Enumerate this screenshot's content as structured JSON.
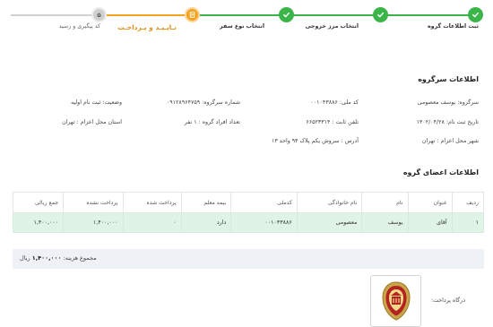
{
  "stepper": {
    "steps": [
      {
        "label": "ثبت اطلاعات گروه",
        "state": "done"
      },
      {
        "label": "انتخاب مرز خروجی",
        "state": "done"
      },
      {
        "label": "انتخاب نوع سفر",
        "state": "done"
      },
      {
        "label": "تـایـیـد و پـرداخـت",
        "state": "current"
      },
      {
        "label": "کد پیگیری و رسید",
        "state": "todo",
        "number": "۵"
      }
    ],
    "colors": {
      "done": "#3bb54a",
      "current": "#f4a21f",
      "todo": "#cfcfcf"
    }
  },
  "leader": {
    "title": "اطلاعات سرگروه",
    "name": "سرگروه: یوسف معصومی",
    "national_code": "کد ملی: ۰۰۱۰۴۳۸۸۶",
    "leader_number": "شماره سرگروه: ۰۹۱۲۸۹۶۴۷۵۹",
    "status": "وضعیت: ثبت نام اولیه",
    "register_date": "تاریخ ثبت نام: ۱۴۰۲/۰۴/۲۸",
    "landline": "تلفن ثابت : ۶۶۵۲۳۳۱۴",
    "group_count": "تعداد افراد گروه : ۱ نفر",
    "province": "استان محل اعزام : تهران",
    "city": "شهر محل اعزام : تهران",
    "address": "آدرس : سروش یکم پلاک ۹۴ واحد ۱۳"
  },
  "members": {
    "title": "اطلاعات اعضای گروه",
    "columns": [
      "ردیف",
      "عنوان",
      "نام",
      "نام خانوادگی",
      "کدملی",
      "بیمه معلم",
      "پرداخت شده",
      "پرداخت نشده",
      "جمع ریالی"
    ],
    "rows": [
      [
        "۱",
        "آقای",
        "یوسف",
        "معصومی",
        "۰۰۱۰۴۳۸۸۶",
        "دارد",
        "۰",
        "۱,۴۰۰,۰۰۰",
        "۱,۴۰۰,۰۰۰"
      ]
    ]
  },
  "total": {
    "label": "مجموع هزینه:",
    "amount": "۱,۴۰۰,۰۰۰",
    "currency": "ریال"
  },
  "gateway": {
    "label": "درگاه پرداخت:",
    "icon": "bank-melli-logo-icon"
  }
}
